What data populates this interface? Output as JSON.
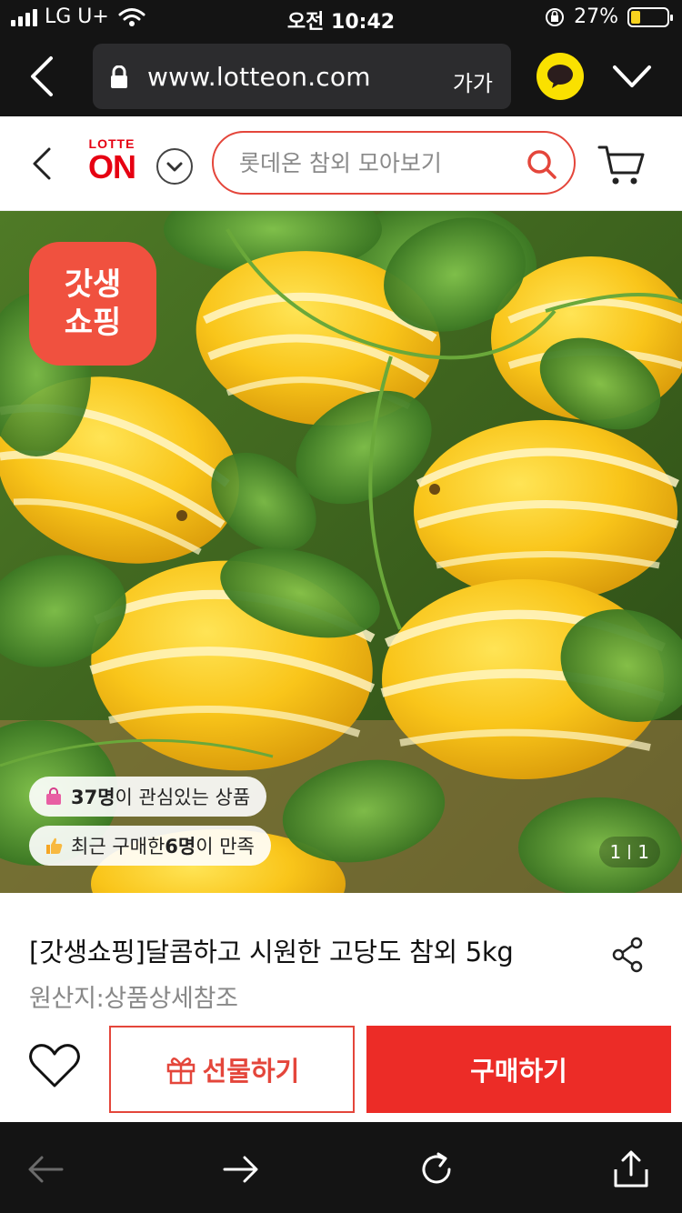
{
  "status_bar": {
    "carrier": "LG U+",
    "time": "오전 10:42",
    "battery_percent": "27%",
    "battery_level": 0.27
  },
  "browser": {
    "url": "www.lotteon.com",
    "text_size_label": "가가"
  },
  "site_header": {
    "logo_top": "LOTTE",
    "logo_bottom": "ON",
    "search_placeholder": "롯데온 참외 모아보기"
  },
  "product_image": {
    "promo_badge_line1": "갓생",
    "promo_badge_line2": "쇼핑",
    "interest_count": "37명",
    "interest_text": "이 관심있는 상품",
    "recent_prefix": "최근 구매한 ",
    "recent_count": "6명",
    "recent_suffix": "이 만족",
    "page_current": "1",
    "page_total": "1"
  },
  "product": {
    "title": "[갓생쇼핑]달콤하고 시원한 고당도 참외 5kg",
    "origin": "원산지:상품상세참조"
  },
  "actions": {
    "gift_label": "선물하기",
    "buy_label": "구매하기"
  },
  "colors": {
    "brand_red": "#e60012",
    "accent_red": "#ec2c27",
    "promo_badge": "#f0513f",
    "kakao_yellow": "#fae100"
  },
  "icons": [
    "back-icon",
    "lock-icon",
    "kakaotalk-icon",
    "chevron-down-icon",
    "search-icon",
    "cart-icon",
    "share-icon",
    "heart-icon",
    "gift-icon",
    "forward-icon",
    "refresh-icon",
    "upload-icon"
  ]
}
